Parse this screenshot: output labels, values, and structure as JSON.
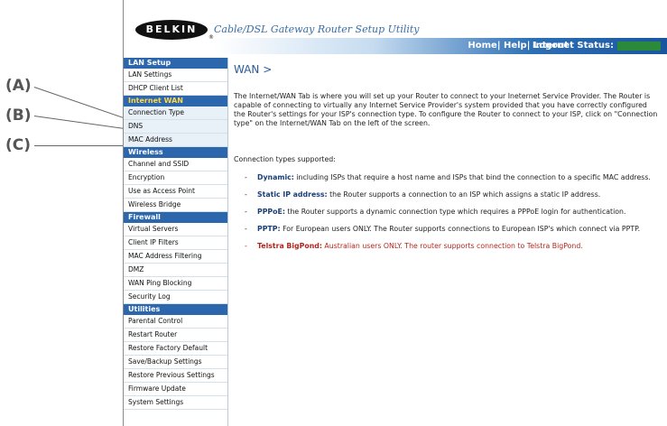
{
  "callouts": [
    {
      "label": "(A)"
    },
    {
      "label": "(B)"
    },
    {
      "label": "(C)"
    }
  ],
  "header": {
    "brand": "BELKIN",
    "brand_mark": "®",
    "app_title": "Cable/DSL Gateway Router Setup Utility",
    "nav_links": "Home| Help| Logout",
    "status_label": "Internet Status:",
    "status_color": "#2a8a3a"
  },
  "sidebar": {
    "sections": [
      {
        "title": "LAN Setup",
        "items": [
          "LAN Settings",
          "DHCP Client List"
        ]
      },
      {
        "title": "Internet WAN",
        "items": [
          "Connection Type",
          "DNS",
          "MAC Address"
        ]
      },
      {
        "title": "Wireless",
        "items": [
          "Channel and SSID",
          "Encryption",
          "Use as Access Point",
          "Wireless Bridge"
        ]
      },
      {
        "title": "Firewall",
        "items": [
          "Virtual Servers",
          "Client IP Filters",
          "MAC Address Filtering",
          "DMZ",
          "WAN Ping Blocking",
          "Security Log"
        ]
      },
      {
        "title": "Utilities",
        "items": [
          "Parental Control",
          "Restart Router",
          "Restore Factory Default",
          "Save/Backup Settings",
          "Restore Previous Settings",
          "Firmware Update",
          "System Settings"
        ]
      }
    ]
  },
  "main": {
    "title": "WAN >",
    "intro": "The Internet/WAN Tab is where you will set up your Router to connect to your Ineternet Service Provider. The Router is capable of connecting to virtually any Internet Service Provider's system provided that you have correctly configured the Router's settings for your ISP's connection type. To configure the Router to connect to your ISP, click on \"Connection type\" on the Internet/WAN Tab on the left of the screen.",
    "supported_label": "Connection types supported:",
    "types": [
      {
        "name": "Dynamic:",
        "desc": " including ISPs that require a host name and ISPs that bind the connection to a specific MAC address."
      },
      {
        "name": "Static IP address:",
        "desc": " the Router supports a connection to an ISP which assigns a static IP address."
      },
      {
        "name": "PPPoE:",
        "desc": " the Router supports a dynamic connection type which requires a PPPoE login for authentication."
      },
      {
        "name": "PPTP:",
        "desc": " For European users ONLY. The Router supports connections to European ISP's which connect via PPTP."
      },
      {
        "name": "Telstra BigPond:",
        "desc": " Australian users ONLY. The router supports connection to Telstra BigPond."
      }
    ]
  }
}
